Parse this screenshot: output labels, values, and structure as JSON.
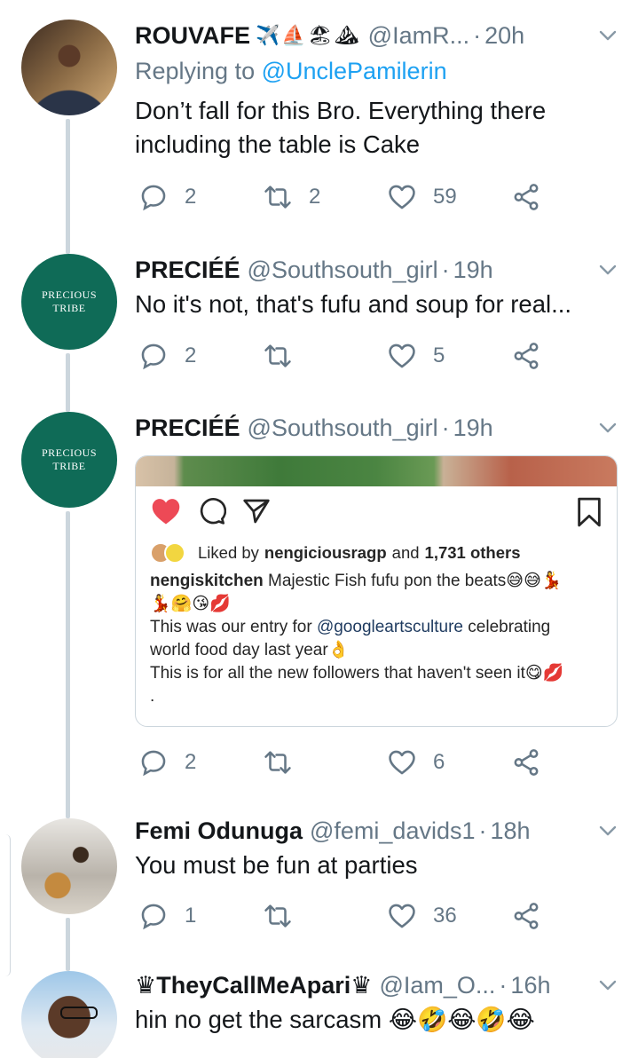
{
  "tweets": [
    {
      "name": "ROUVAFE",
      "name_emojis": "✈️⛵🏖⛰",
      "handle": "@IamR...",
      "time": "20h",
      "replying_label": "Replying to",
      "replying_to": "@UnclePamilerin",
      "text": "Don’t fall for this Bro. Everything there including the table is Cake",
      "replies": "2",
      "retweets": "2",
      "likes": "59"
    },
    {
      "name": "PRECIÉÉ",
      "handle": "@Southsouth_girl",
      "time": "19h",
      "text": "No it's not, that's fufu and soup for real...",
      "replies": "2",
      "retweets": "",
      "likes": "5",
      "avatar_text": "PRECIOUS TRIBE"
    },
    {
      "name": "PRECIÉÉ",
      "handle": "@Southsouth_girl",
      "time": "19h",
      "replies": "2",
      "retweets": "",
      "likes": "6",
      "avatar_text": "PRECIOUS TRIBE"
    },
    {
      "name": "Femi Odunuga",
      "handle": "@femi_davids1",
      "time": "18h",
      "text": "You must be fun at parties",
      "replies": "1",
      "retweets": "",
      "likes": "36"
    },
    {
      "name": "♛TheyCallMeApari♛",
      "handle": "@Iam_O...",
      "time": "16h",
      "text": "hin no get the sarcasm 😂🤣😂🤣😂"
    }
  ],
  "instagram": {
    "liked_prefix": "Liked by",
    "liked_user": "nengiciousragp",
    "liked_and": "and",
    "liked_count": "1,731 others",
    "caption_user": "nengiskitchen",
    "caption_line1": "Majestic Fish fufu pon the beats😅😅💃",
    "caption_line2": "💃🤗😘💋",
    "caption_line3_pre": "This was our entry for",
    "caption_mention": "@googleartsculture",
    "caption_line3_post": "celebrating",
    "caption_line4": "world food day last year👌",
    "caption_line5": "This is for all the new followers that haven't seen it😋💋",
    "caption_line6": "."
  },
  "colors": {
    "text": "#14171a",
    "secondary": "#657786",
    "link": "#1da1f2",
    "thread_line": "#ccd6dd",
    "ig_heart": "#ed4956",
    "avatar_green": "#0f6b57"
  }
}
